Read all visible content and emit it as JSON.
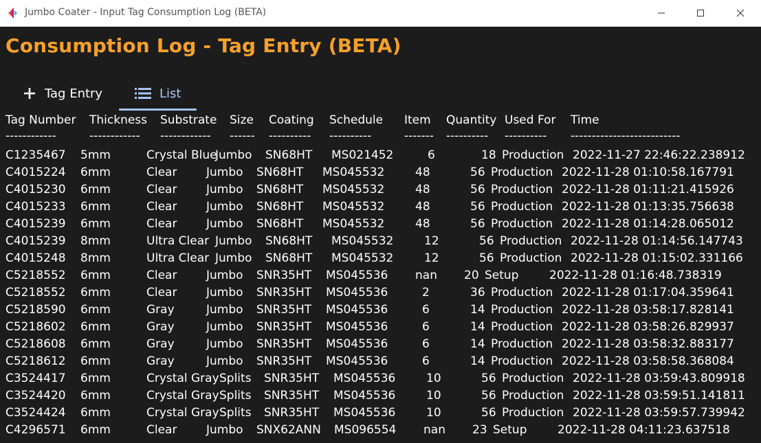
{
  "window": {
    "title": "Jumbo Coater - Input Tag Consumption Log (BETA)",
    "controls": [
      "minimize",
      "maximize",
      "close"
    ]
  },
  "app": {
    "title": "Consumption Log - Tag Entry (BETA)",
    "accent_color": "#f5a02a",
    "background_color": "#1c1c1c"
  },
  "tabs": {
    "entry": {
      "label": "Tag Entry",
      "icon": "plus-icon"
    },
    "list": {
      "label": "List",
      "icon": "list-icon",
      "selected": true,
      "color": "#a8c7fa"
    }
  },
  "table": {
    "headers": [
      "Tag Number",
      "Thickness",
      "Substrate",
      "Size",
      "Coating",
      "Schedule",
      "Item",
      "Quantity",
      "Used For",
      "Time"
    ],
    "separators": [
      "------------",
      "------------",
      "------------",
      "------",
      "----------",
      "----------",
      "-------",
      "----------",
      "----------",
      "--------------------------"
    ],
    "rows": [
      [
        "C1235467",
        "5mm",
        "Crystal Blue",
        "Jumbo",
        "SN68HT",
        "MS021452",
        "6",
        "18",
        "Production",
        "2022-11-27 22:46:22.238912"
      ],
      [
        "C4015224",
        "6mm",
        "Clear",
        "Jumbo",
        "SN68HT",
        "MS045532",
        "48",
        "56",
        "Production",
        "2022-11-28 01:10:58.167791"
      ],
      [
        "C4015230",
        "6mm",
        "Clear",
        "Jumbo",
        "SN68HT",
        "MS045532",
        "48",
        "56",
        "Production",
        "2022-11-28 01:11:21.415926"
      ],
      [
        "C4015233",
        "6mm",
        "Clear",
        "Jumbo",
        "SN68HT",
        "MS045532",
        "48",
        "56",
        "Production",
        "2022-11-28 01:13:35.756638"
      ],
      [
        "C4015239",
        "6mm",
        "Clear",
        "Jumbo",
        "SN68HT",
        "MS045532",
        "48",
        "56",
        "Production",
        "2022-11-28 01:14:28.065012"
      ],
      [
        "C4015239",
        "8mm",
        "Ultra Clear",
        "Jumbo",
        "SN68HT",
        "MS045532",
        "12",
        "56",
        "Production",
        "2022-11-28 01:14:56.147743"
      ],
      [
        "C4015248",
        "8mm",
        "Ultra Clear",
        "Jumbo",
        "SN68HT",
        "MS045532",
        "12",
        "56",
        "Production",
        "2022-11-28 01:15:02.331166"
      ],
      [
        "C5218552",
        "6mm",
        "Clear",
        "Jumbo",
        "SNR35HT",
        "MS045536",
        "nan",
        "20",
        "Setup",
        "2022-11-28 01:16:48.738319"
      ],
      [
        "C5218552",
        "6mm",
        "Clear",
        "Jumbo",
        "SNR35HT",
        "MS045536",
        "2",
        "36",
        "Production",
        "2022-11-28 01:17:04.359641"
      ],
      [
        "C5218590",
        "6mm",
        "Gray",
        "Jumbo",
        "SNR35HT",
        "MS045536",
        "6",
        "14",
        "Production",
        "2022-11-28 03:58:17.828141"
      ],
      [
        "C5218602",
        "6mm",
        "Gray",
        "Jumbo",
        "SNR35HT",
        "MS045536",
        "6",
        "14",
        "Production",
        "2022-11-28 03:58:26.829937"
      ],
      [
        "C5218608",
        "6mm",
        "Gray",
        "Jumbo",
        "SNR35HT",
        "MS045536",
        "6",
        "14",
        "Production",
        "2022-11-28 03:58:32.883177"
      ],
      [
        "C5218612",
        "6mm",
        "Gray",
        "Jumbo",
        "SNR35HT",
        "MS045536",
        "6",
        "14",
        "Production",
        "2022-11-28 03:58:58.368084"
      ],
      [
        "C3524417",
        "6mm",
        "Crystal Gray",
        "Splits",
        "SNR35HT",
        "MS045536",
        "10",
        "56",
        "Production",
        "2022-11-28 03:59:43.809918"
      ],
      [
        "C3524420",
        "6mm",
        "Crystal Gray",
        "Splits",
        "SNR35HT",
        "MS045536",
        "10",
        "56",
        "Production",
        "2022-11-28 03:59:51.141811"
      ],
      [
        "C3524424",
        "6mm",
        "Crystal Gray",
        "Splits",
        "SNR35HT",
        "MS045536",
        "10",
        "56",
        "Production",
        "2022-11-28 03:59:57.739942"
      ],
      [
        "C4296571",
        "6mm",
        "Clear",
        "Jumbo",
        "SNX62ANN",
        "MS096554",
        "nan",
        "23",
        "Setup",
        "2022-11-28 04:11:23.637518"
      ]
    ]
  }
}
